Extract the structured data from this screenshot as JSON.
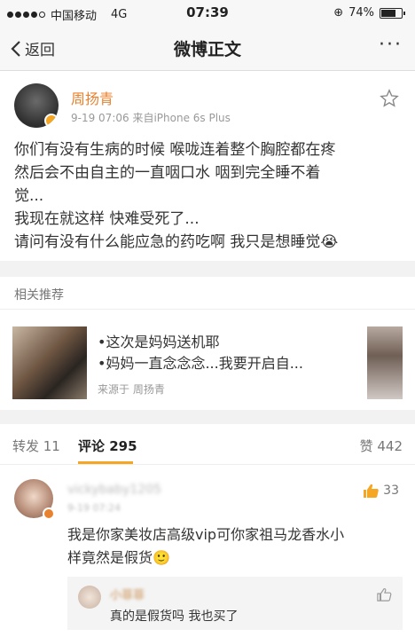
{
  "status_bar": {
    "carrier": "中国移动",
    "network": "4G",
    "time": "07:39",
    "battery": "74%",
    "battery_level": 0.74
  },
  "nav": {
    "back_label": "返回",
    "title": "微博正文",
    "more_label": "···"
  },
  "post": {
    "author": "周扬青",
    "meta": "9-19 07:06  来自iPhone 6s Plus",
    "lines": [
      "你们有没有生病的时候 喉咙连着整个胸腔都在疼",
      "然后会不由自主的一直咽口水 咽到完全睡不着",
      "觉...",
      "我现在就这样 快难受死了...",
      "请问有没有什么能应急的药吃啊 我只是想睡觉😭"
    ]
  },
  "recommend": {
    "header": "相关推荐",
    "line1": "•这次是妈妈送机耶",
    "line2": "•妈妈一直念念念...我要开启自...",
    "source": "来源于 周扬青"
  },
  "tabs": {
    "repost": "转发 11",
    "comment": "评论 295",
    "like": "赞 442"
  },
  "comment": {
    "user": "vickybaby1205",
    "date": "9-19 07:24",
    "likes": "33",
    "text_line1": "我是你家美妆店高级vip可你家祖马龙香水小",
    "text_line2": "样竟然是假货🙂"
  },
  "reply": {
    "user": "小菲菲",
    "text": "真的是假货吗 我也买了"
  }
}
